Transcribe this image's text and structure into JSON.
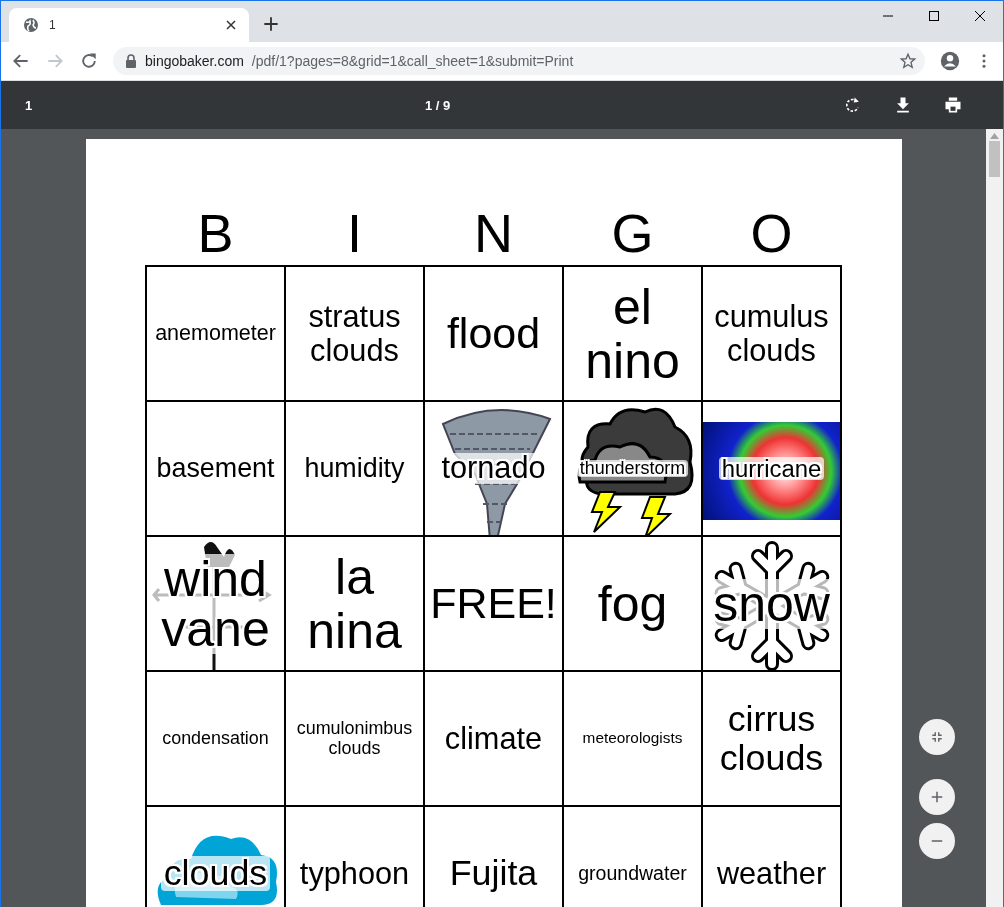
{
  "browser": {
    "tab_title": "1",
    "url_host": "bingobaker.com",
    "url_path": "/pdf/1?pages=8&grid=1&call_sheet=1&submit=Print",
    "back_disabled": false,
    "forward_disabled": true
  },
  "pdf_toolbar": {
    "title": "1",
    "page_indicator": "1 / 9"
  },
  "card": {
    "header": [
      "B",
      "I",
      "N",
      "G",
      "O"
    ],
    "rows": [
      [
        {
          "text": "anemometer",
          "kind": "text"
        },
        {
          "text": "stratus clouds",
          "kind": "text"
        },
        {
          "text": "flood",
          "kind": "text"
        },
        {
          "text": "el nino",
          "kind": "text"
        },
        {
          "text": "cumulus clouds",
          "kind": "text"
        }
      ],
      [
        {
          "text": "basement",
          "kind": "text"
        },
        {
          "text": "humidity",
          "kind": "text"
        },
        {
          "text": "tornado",
          "kind": "tornado"
        },
        {
          "text": "thunderstorm",
          "kind": "thunderstorm"
        },
        {
          "text": "hurricane",
          "kind": "satellite"
        }
      ],
      [
        {
          "text": "wind vane",
          "kind": "vane"
        },
        {
          "text": "la nina",
          "kind": "text"
        },
        {
          "text": "FREE!",
          "kind": "text"
        },
        {
          "text": "fog",
          "kind": "text"
        },
        {
          "text": "snow",
          "kind": "snowflake"
        }
      ],
      [
        {
          "text": "condensation",
          "kind": "text"
        },
        {
          "text": "cumulonimbus clouds",
          "kind": "text"
        },
        {
          "text": "climate",
          "kind": "text"
        },
        {
          "text": "meteorologists",
          "kind": "text"
        },
        {
          "text": "cirrus clouds",
          "kind": "text"
        }
      ],
      [
        {
          "text": "clouds",
          "kind": "cloud"
        },
        {
          "text": "typhoon",
          "kind": "text"
        },
        {
          "text": "Fujita",
          "kind": "text"
        },
        {
          "text": "groundwater",
          "kind": "text"
        },
        {
          "text": "weather",
          "kind": "text"
        }
      ]
    ]
  }
}
